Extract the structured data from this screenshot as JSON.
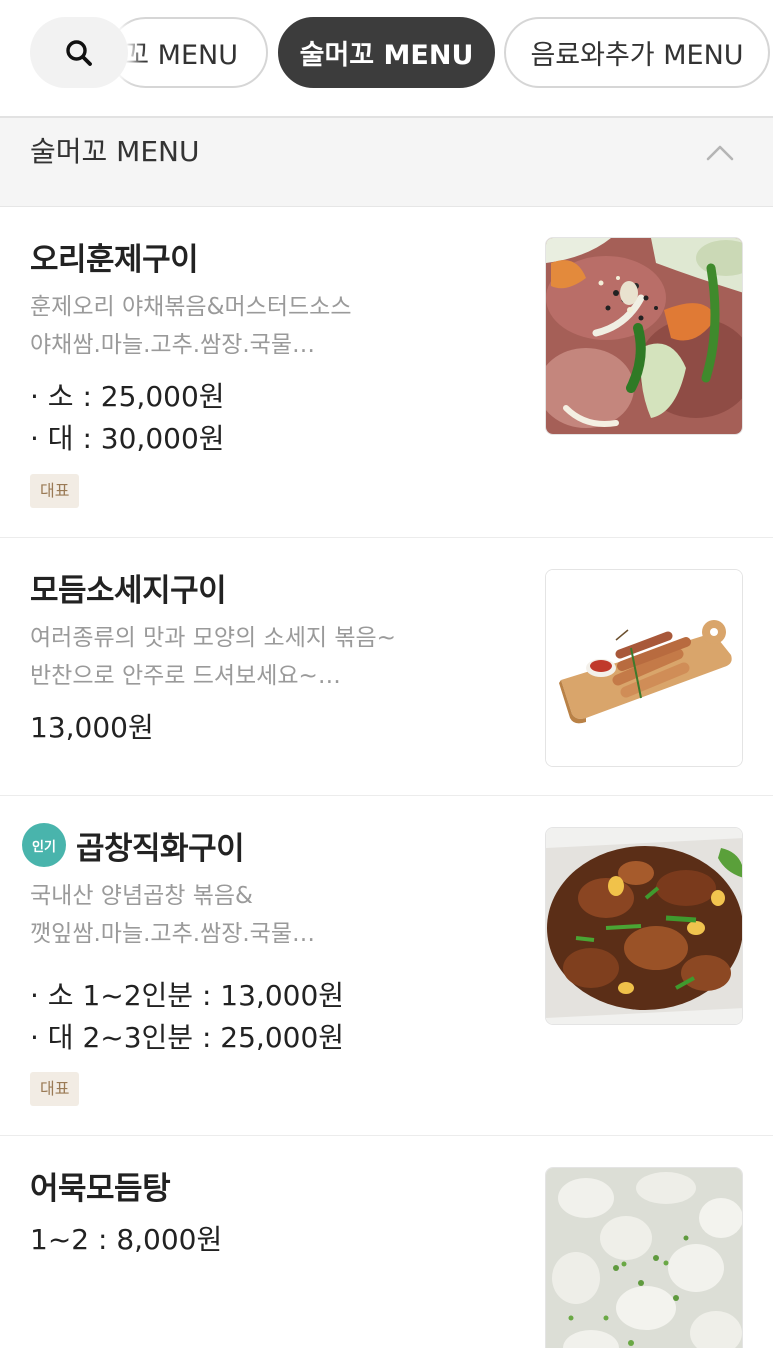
{
  "tabs": {
    "search_icon": "search-icon",
    "prev_label": "꼬 MENU",
    "active_label": "술머꼬 MENU",
    "next_label": "음료와추가 MENU"
  },
  "section": {
    "title": "술머꼬 MENU",
    "toggle_icon": "chevron-up-icon"
  },
  "items": [
    {
      "name": "오리훈제구이",
      "desc": [
        "훈제오리 야채볶음&머스터드소스",
        "야채쌈.마늘.고추.쌈장.국물…"
      ],
      "prices": [
        "· 소 : 25,000원",
        "· 대 : 30,000원"
      ],
      "tag": "대표",
      "image": "smoked-duck-stir-fry-photo"
    },
    {
      "name": "모듬소세지구이",
      "desc": [
        "여러종류의 맛과 모양의 소세지 볶음~",
        "반찬으로 안주로 드셔보세요~…"
      ],
      "prices": [
        "13,000원"
      ],
      "image": "assorted-sausage-board-photo"
    },
    {
      "badge": "인기",
      "name": "곱창직화구이",
      "desc": [
        "국내산 양념곱창 볶음&",
        "깻잎쌈.마늘.고추.쌈장.국물…"
      ],
      "prices": [
        "· 소 1~2인분 : 13,000원",
        "· 대 2~3인분 : 25,000원"
      ],
      "tag": "대표",
      "image": "grilled-gopchang-photo"
    },
    {
      "name": "어묵모듬탕",
      "prices": [
        "1~2 : 8,000원"
      ],
      "image": "fish-cake-soup-photo"
    }
  ],
  "colors": {
    "active_chip": "#3c3c3c",
    "section_bg": "#f5f5f5",
    "popular_badge": "#49b4ac",
    "tag_bg": "#f2ece4",
    "tag_text": "#9a7a55",
    "desc_text": "#9a9a9a"
  }
}
